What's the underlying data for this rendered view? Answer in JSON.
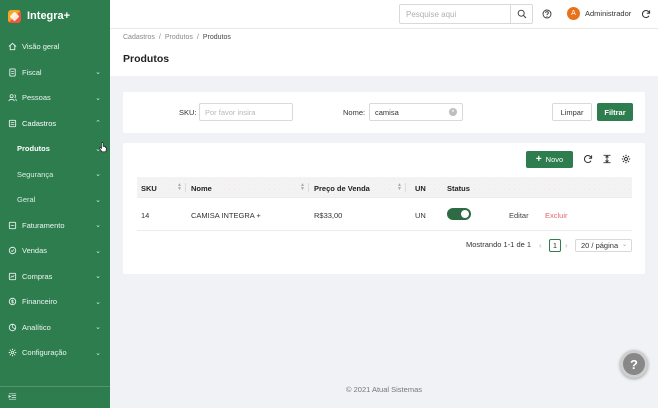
{
  "brand": {
    "name": "Integra+"
  },
  "sidebar": {
    "items": [
      {
        "label": "Visão geral",
        "icon": "home-icon",
        "chevron": ""
      },
      {
        "label": "Fiscal",
        "icon": "file-icon",
        "chevron": "⌄"
      },
      {
        "label": "Pessoas",
        "icon": "users-icon",
        "chevron": "⌄"
      },
      {
        "label": "Cadastros",
        "icon": "folder-icon",
        "chevron": "⌃"
      },
      {
        "label": "Produtos",
        "icon": "",
        "chevron": "⌄"
      },
      {
        "label": "Segurança",
        "icon": "",
        "chevron": "⌄"
      },
      {
        "label": "Geral",
        "icon": "",
        "chevron": "⌄"
      },
      {
        "label": "Faturamento",
        "icon": "invoice-icon",
        "chevron": "⌄"
      },
      {
        "label": "Vendas",
        "icon": "sales-icon",
        "chevron": "⌄"
      },
      {
        "label": "Compras",
        "icon": "cart-icon",
        "chevron": "⌄"
      },
      {
        "label": "Financeiro",
        "icon": "money-icon",
        "chevron": "⌄"
      },
      {
        "label": "Analítico",
        "icon": "chart-icon",
        "chevron": "⌄"
      },
      {
        "label": "Configuração",
        "icon": "gear-icon",
        "chevron": "⌄"
      }
    ]
  },
  "header": {
    "search_placeholder": "Pesquise aqui",
    "avatar_letter": "A",
    "username": "Administrador"
  },
  "breadcrumb": [
    "Cadastros",
    "Produtos",
    "Produtos"
  ],
  "page_title": "Produtos",
  "filter": {
    "sku_label": "SKU:",
    "sku_placeholder": "Por favor insira",
    "sku_value": "",
    "nome_label": "Nome:",
    "nome_value": "camisa",
    "clear_label": "Limpar",
    "filter_label": "Filtrar"
  },
  "table": {
    "new_label": "Novo",
    "columns": [
      "SKU",
      "Nome",
      "Preço de Venda",
      "UN",
      "Status"
    ],
    "rows": [
      {
        "sku": "14",
        "nome": "CAMISA INTEGRA +",
        "preco": "R$33,00",
        "un": "UN",
        "status": "on",
        "edit": "Editar",
        "delete": "Excluir"
      }
    ],
    "pagination": {
      "summary": "Mostrando 1-1 de 1",
      "current_page": "1",
      "page_size": "20 / página"
    }
  },
  "footer": {
    "copyright": "© 2021 Atual Sistemas"
  },
  "help_button": "?",
  "colors": {
    "sidebar": "#2e7d4f",
    "primary": "#2e7d4f",
    "delete": "#e26a6a",
    "avatar": "#e8721c"
  }
}
